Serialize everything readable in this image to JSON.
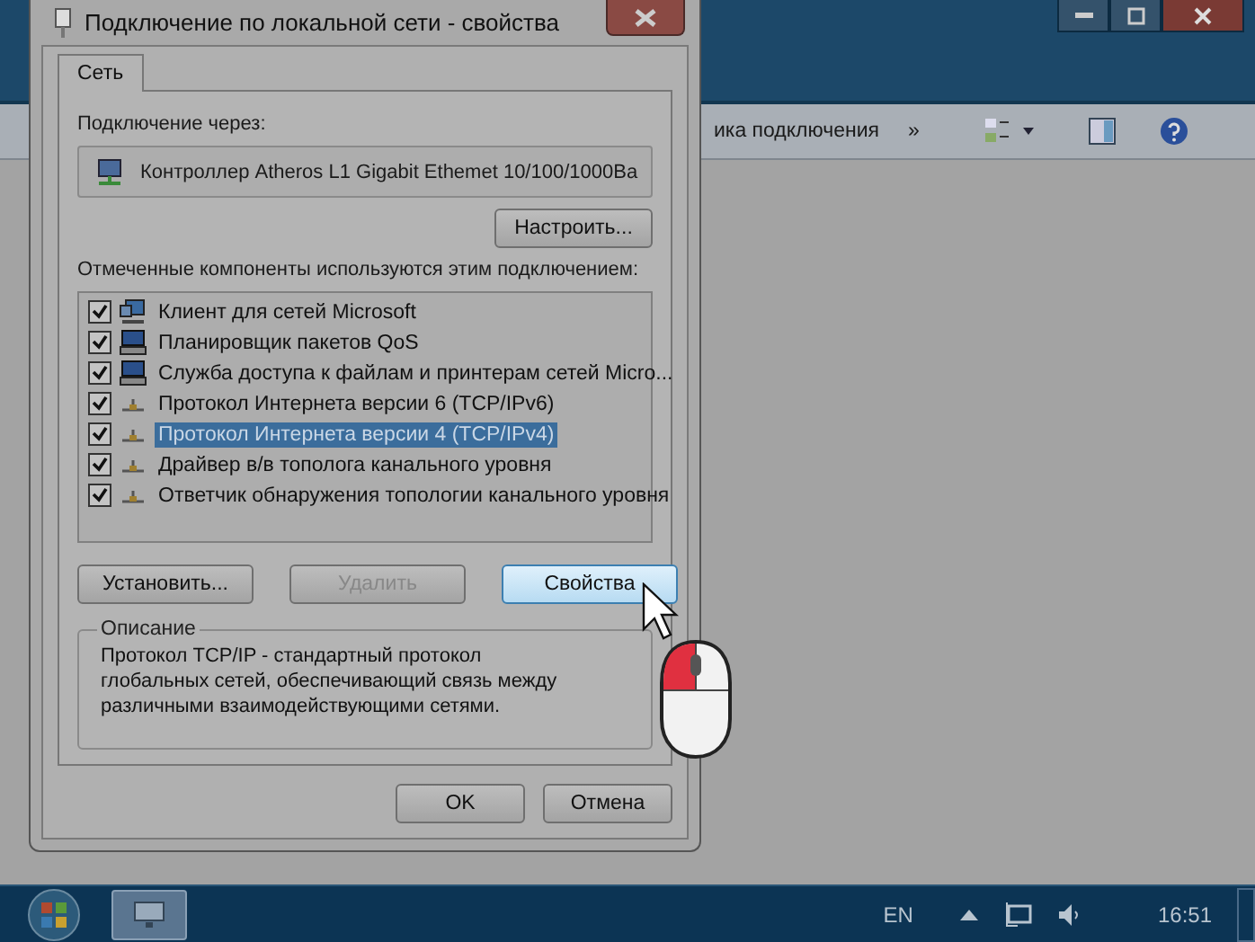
{
  "background_window": {
    "toolbar_text": "ика подключения",
    "chevron": "»"
  },
  "dialog": {
    "title": "Подключение по локальной сети - свойства",
    "tabs": [
      {
        "label": "Сеть",
        "selected": true
      }
    ],
    "connect_label": "Подключение через:",
    "adapter": "Контроллер Atheros L1 Gigabit Ethemet 10/100/1000Ba",
    "configure_button": "Настроить...",
    "components_label": "Отмеченные компоненты используются этим подключением:",
    "components": [
      {
        "kind": "client",
        "label": "Клиент для сетей Microsoft",
        "checked": true,
        "selected": false
      },
      {
        "kind": "service",
        "label": "Планировщик пакетов QoS",
        "checked": true,
        "selected": false
      },
      {
        "kind": "service",
        "label": "Служба доступа к файлам и принтерам сетей Micro...",
        "checked": true,
        "selected": false
      },
      {
        "kind": "protocol",
        "label": "Протокол Интернета версии 6 (TCP/IPv6)",
        "checked": true,
        "selected": false
      },
      {
        "kind": "protocol",
        "label": "Протокол Интернета версии 4 (TCP/IPv4)",
        "checked": true,
        "selected": true
      },
      {
        "kind": "protocol",
        "label": "Драйвер в/в тополога канального уровня",
        "checked": true,
        "selected": false
      },
      {
        "kind": "protocol",
        "label": "Ответчик обнаружения топологии канального уровня",
        "checked": true,
        "selected": false
      }
    ],
    "actions": [
      {
        "label": "Установить...",
        "disabled": false,
        "hot": false
      },
      {
        "label": "Удалить",
        "disabled": true,
        "hot": false
      },
      {
        "label": "Свойства",
        "disabled": false,
        "hot": true
      }
    ],
    "description_title": "Описание",
    "description": "Протокол TCP/IP - стандартный протокол глобальных сетей, обеспечивающий связь между различными взаимодействующими сетями.",
    "buttons": [
      "OK",
      "Отмена"
    ]
  },
  "taskbar": {
    "language": "EN",
    "clock": "16:51"
  }
}
